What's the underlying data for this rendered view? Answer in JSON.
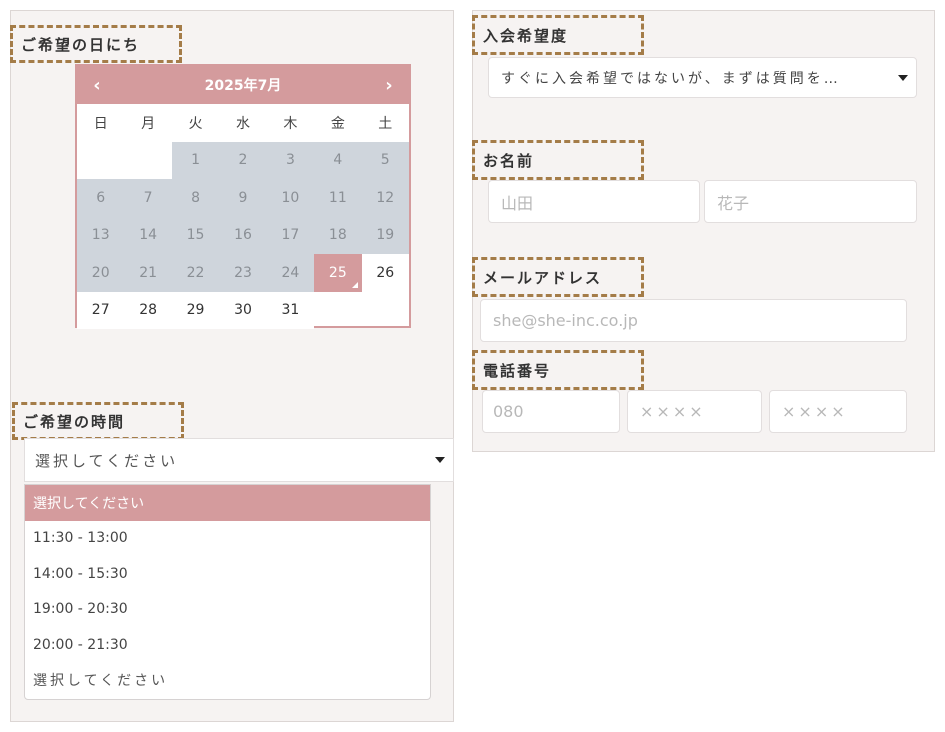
{
  "date_section": {
    "label": "ご希望の日にち",
    "calendar": {
      "month_title": "2025年7月",
      "prev_icon": "‹",
      "next_icon": "›",
      "weekdays": [
        "日",
        "月",
        "火",
        "水",
        "木",
        "金",
        "土"
      ],
      "today": "25"
    }
  },
  "time_section": {
    "label": "ご希望の時間",
    "selected_value": "選択してください",
    "options": [
      "選択してください",
      "11:30 - 13:00",
      "14:00 - 15:30",
      "19:00 - 20:30",
      "20:00 - 21:30",
      "選択してください"
    ]
  },
  "membership_section": {
    "label": "入会希望度",
    "selected_value": "すぐに入会希望ではないが、まずは質問を…"
  },
  "name_section": {
    "label": "お名前",
    "last_name_placeholder": "山田",
    "first_name_placeholder": "花子"
  },
  "email_section": {
    "label": "メールアドレス",
    "placeholder": "she@she-inc.co.jp"
  },
  "phone_section": {
    "label": "電話番号",
    "part1_placeholder": "080",
    "part2_placeholder": "××××",
    "part3_placeholder": "××××"
  },
  "colors": {
    "accent": "#d49b9d",
    "label_border": "#a47c48",
    "disabled_day": "#cfd5dc"
  }
}
